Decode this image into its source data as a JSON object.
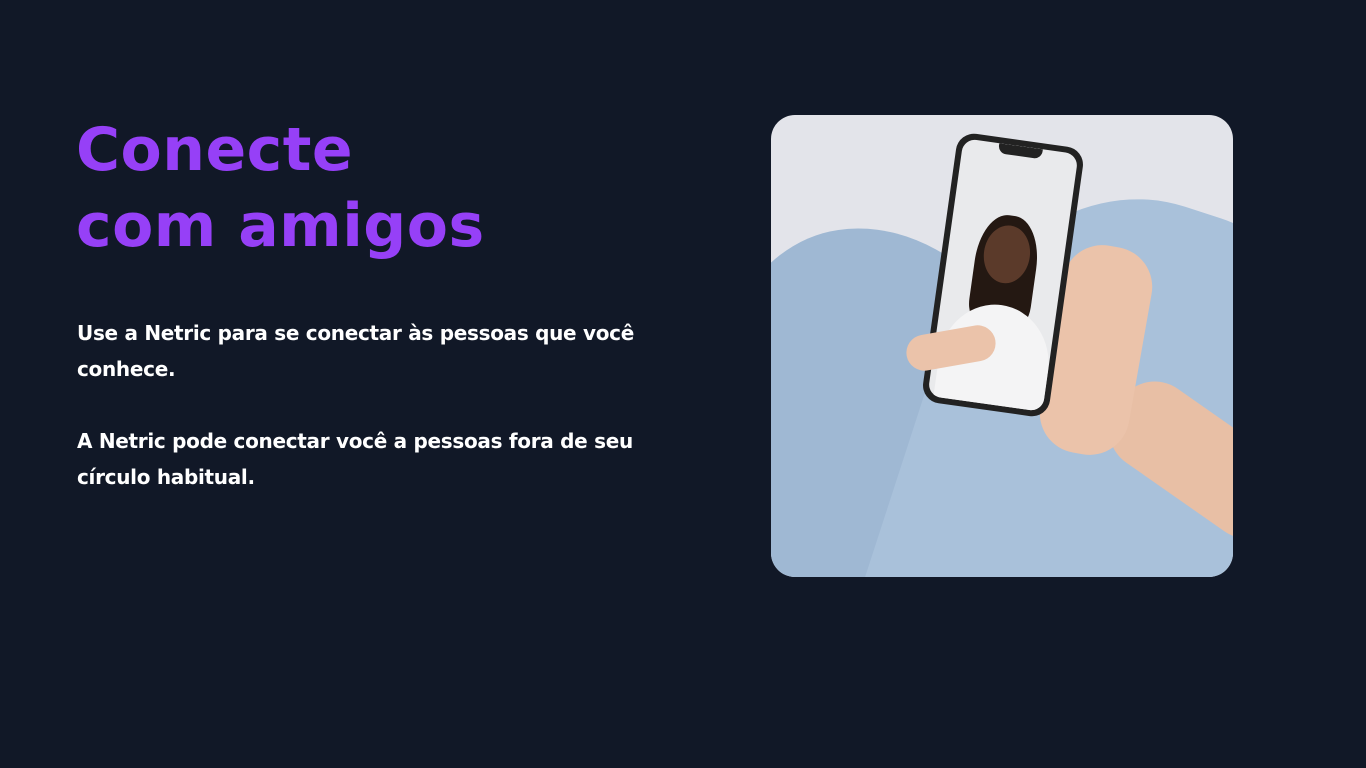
{
  "heading": {
    "line1": "Conecte",
    "line2": "com amigos"
  },
  "paragraphs": [
    "Use a Netric para se conectar às pessoas que você conhece.",
    "A Netric pode conectar você a pessoas fora de seu círculo habitual."
  ],
  "colors": {
    "background": "#111827",
    "accent": "#9640f7",
    "text": "#ffffff"
  }
}
